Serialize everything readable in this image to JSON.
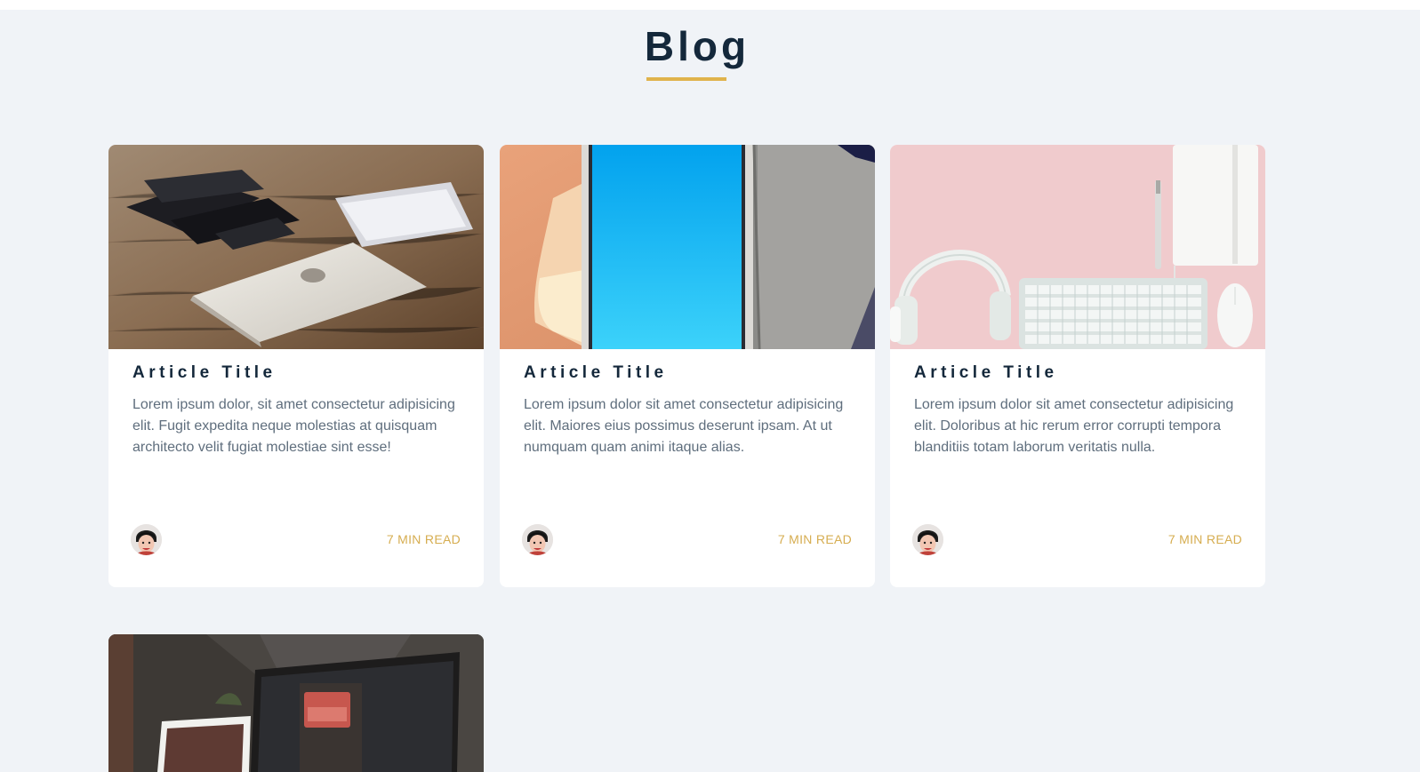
{
  "blog": {
    "title": "Blog",
    "accent_color": "#e0b34c",
    "posts": [
      {
        "image_icon": "laptop-devices-photo",
        "title": "Article Title",
        "excerpt": "Lorem ipsum dolor, sit amet consectetur adipisicing elit. Fugit expedita neque molestias at quisquam architecto velit fugiat molestiae sint esse!",
        "read_time": "7 MIN READ"
      },
      {
        "image_icon": "tablet-blue-screen-photo",
        "title": "Article Title",
        "excerpt": "Lorem ipsum dolor sit amet consectetur adipisicing elit. Maiores eius possimus deserunt ipsam. At ut numquam quam animi itaque alias.",
        "read_time": "7 MIN READ"
      },
      {
        "image_icon": "headphones-keyboard-photo",
        "title": "Article Title",
        "excerpt": "Lorem ipsum dolor sit amet consectetur adipisicing elit. Doloribus at hic rerum error corrupti tempora blanditiis totam laborum veritatis nulla.",
        "read_time": "7 MIN READ"
      },
      {
        "image_icon": "laptop-open-sign-photo"
      }
    ]
  }
}
